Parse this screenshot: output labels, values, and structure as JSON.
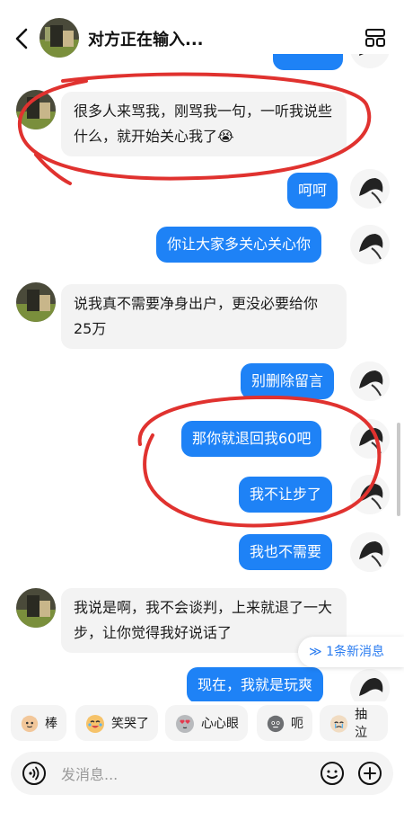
{
  "header": {
    "title": "对方正在输入...",
    "back_icon": "chevron-left-icon",
    "menu_icon": "grid-menu-icon"
  },
  "messages": [
    {
      "side": "in",
      "text": "很多人来骂我，刚骂我一句，一听我说些什么，就开始关心我了😭"
    },
    {
      "side": "out",
      "text": "呵呵"
    },
    {
      "side": "out",
      "text": "你让大家多关心关心你"
    },
    {
      "side": "in",
      "text": "说我真不需要净身出户，更没必要给你25万"
    },
    {
      "side": "out",
      "text": "别删除留言"
    },
    {
      "side": "out",
      "text": "那你就退回我60吧"
    },
    {
      "side": "out",
      "text": "我不让步了"
    },
    {
      "side": "out",
      "text": "我也不需要"
    },
    {
      "side": "in",
      "text": "我说是啊，我不会谈判，上来就退了一大步，让你觉得我好说话了"
    },
    {
      "side": "out",
      "text": "现在，我就是玩爽"
    }
  ],
  "new_messages_pill": "≫ 1条新消息",
  "stickers": [
    {
      "label": "棒",
      "icon": "cat-thumbs-icon"
    },
    {
      "label": "笑哭了",
      "icon": "cat-laugh-cry-icon"
    },
    {
      "label": "心心眼",
      "icon": "cat-heart-eyes-icon"
    },
    {
      "label": "呃",
      "icon": "cat-awkward-icon"
    },
    {
      "label": "抽泣",
      "icon": "cat-sob-icon"
    }
  ],
  "input": {
    "placeholder": "发消息...",
    "voice_icon": "voice-icon",
    "emoji_icon": "emoji-icon",
    "plus_icon": "plus-icon"
  },
  "colors": {
    "outgoing_bubble": "#1e82f6",
    "incoming_bubble": "#f3f3f3",
    "annotation_red": "#e0322f",
    "accent_blue": "#2a7cf0"
  }
}
